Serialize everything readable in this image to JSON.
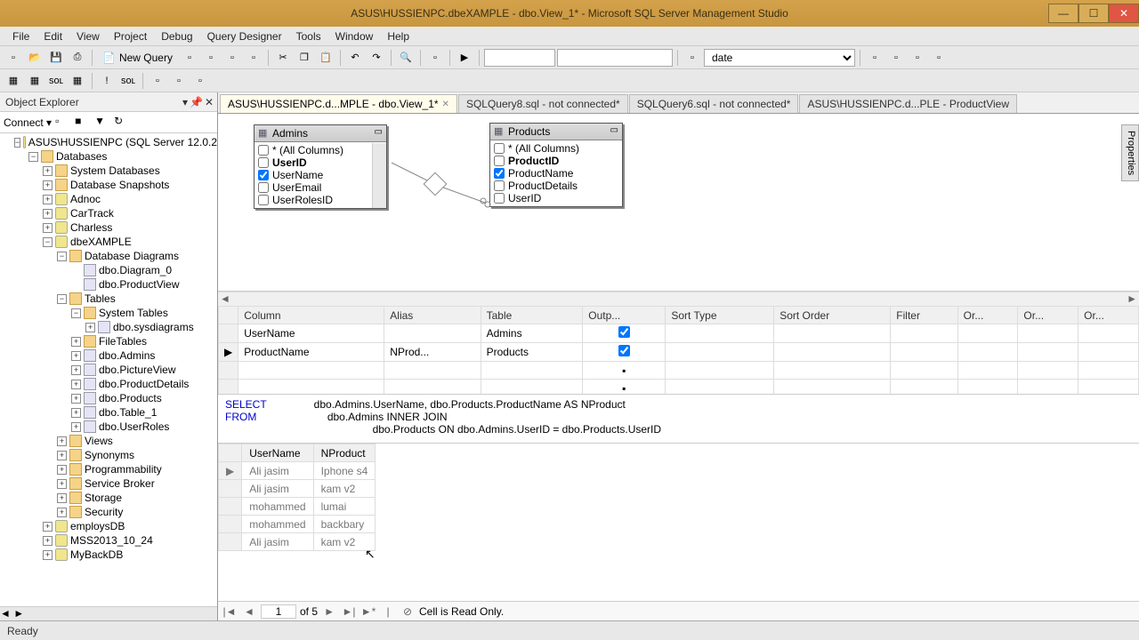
{
  "title": "ASUS\\HUSSIENPC.dbeXAMPLE - dbo.View_1* - Microsoft SQL Server Management Studio",
  "menu": [
    "File",
    "Edit",
    "View",
    "Project",
    "Debug",
    "Query Designer",
    "Tools",
    "Window",
    "Help"
  ],
  "toolbar": {
    "newquery": "New Query",
    "combo": "date"
  },
  "explorer": {
    "title": "Object Explorer",
    "connect": "Connect ▾",
    "root": "ASUS\\HUSSIENPC (SQL Server 12.0.2",
    "nodes": {
      "databases": "Databases",
      "sysdb": "System Databases",
      "snapshots": "Database Snapshots",
      "adnoc": "Adnoc",
      "cartrack": "CarTrack",
      "charless": "Charless",
      "dbex": "dbeXAMPLE",
      "dbdiag": "Database Diagrams",
      "diag0": "dbo.Diagram_0",
      "prodview": "dbo.ProductView",
      "tables": "Tables",
      "systables": "System Tables",
      "sysdiag": "dbo.sysdiagrams",
      "filetables": "FileTables",
      "admins": "dbo.Admins",
      "picview": "dbo.PictureView",
      "proddet": "dbo.ProductDetails",
      "products": "dbo.Products",
      "table1": "dbo.Table_1",
      "userroles": "dbo.UserRoles",
      "views": "Views",
      "synonyms": "Synonyms",
      "prog": "Programmability",
      "sb": "Service Broker",
      "storage": "Storage",
      "security": "Security",
      "employs": "employsDB",
      "mss": "MSS2013_10_24",
      "myback": "MyBackDB"
    }
  },
  "tabs": [
    {
      "label": "ASUS\\HUSSIENPC.d...MPLE - dbo.View_1*",
      "active": true,
      "close": true
    },
    {
      "label": "SQLQuery8.sql - not connected*",
      "active": false,
      "close": false
    },
    {
      "label": "SQLQuery6.sql - not connected*",
      "active": false,
      "close": false
    },
    {
      "label": "ASUS\\HUSSIENPC.d...PLE - ProductView",
      "active": false,
      "close": false
    }
  ],
  "diagram": {
    "admins": {
      "title": "Admins",
      "cols": [
        {
          "name": "* (All Columns)",
          "chk": false
        },
        {
          "name": "UserID",
          "chk": false,
          "bold": true
        },
        {
          "name": "UserName",
          "chk": true
        },
        {
          "name": "UserEmail",
          "chk": false
        },
        {
          "name": "UserRolesID",
          "chk": false
        }
      ]
    },
    "products": {
      "title": "Products",
      "cols": [
        {
          "name": "* (All Columns)",
          "chk": false
        },
        {
          "name": "ProductID",
          "chk": false,
          "bold": true
        },
        {
          "name": "ProductName",
          "chk": true
        },
        {
          "name": "ProductDetails",
          "chk": false
        },
        {
          "name": "UserID",
          "chk": false
        }
      ]
    }
  },
  "criteria": {
    "headers": [
      "Column",
      "Alias",
      "Table",
      "Outp...",
      "Sort Type",
      "Sort Order",
      "Filter",
      "Or...",
      "Or...",
      "Or..."
    ],
    "rows": [
      {
        "column": "UserName",
        "alias": "",
        "table": "Admins",
        "out": true
      },
      {
        "column": "ProductName",
        "alias": "NProd...",
        "table": "Products",
        "out": true
      }
    ]
  },
  "sql": {
    "select": "SELECT",
    "selectBody": "dbo.Admins.UserName, dbo.Products.ProductName AS NProduct",
    "from": "FROM",
    "fromBody": "dbo.Admins INNER JOIN",
    "on": "dbo.Products ON dbo.Admins.UserID = dbo.Products.UserID"
  },
  "results": {
    "headers": [
      "UserName",
      "NProduct"
    ],
    "rows": [
      [
        "Ali  jasim",
        "Iphone s4"
      ],
      [
        "Ali  jasim",
        "kam v2"
      ],
      [
        "mohammed",
        "lumai"
      ],
      [
        "mohammed",
        "backbary"
      ],
      [
        "Ali  jasim",
        "kam v2"
      ]
    ],
    "nav": {
      "pos": "1",
      "total": "of 5",
      "status": "Cell is Read Only."
    }
  },
  "status": "Ready",
  "props": "Properties"
}
